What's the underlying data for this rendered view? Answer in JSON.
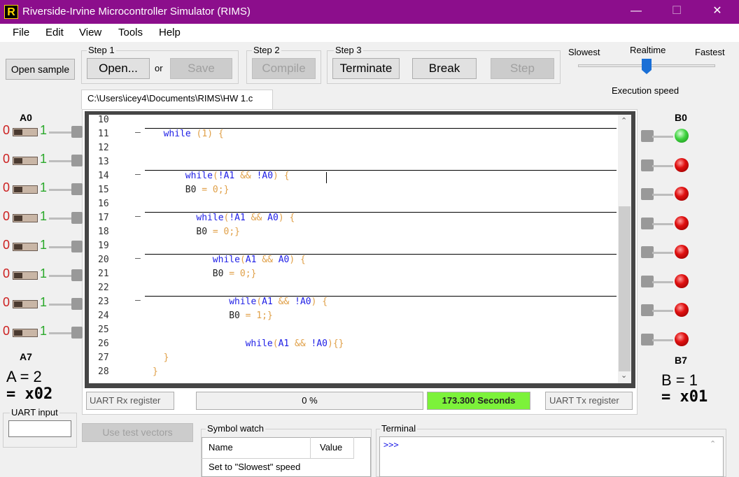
{
  "window": {
    "icon_letter": "R",
    "title": "Riverside-Irvine Microcontroller Simulator (RIMS)",
    "minimize": "—",
    "maximize": "☐",
    "close": "✕"
  },
  "menu": [
    "File",
    "Edit",
    "View",
    "Tools",
    "Help"
  ],
  "toolbar": {
    "open_sample": "Open sample",
    "step1": "Step 1",
    "open": "Open...",
    "or": "or",
    "save": "Save",
    "step2": "Step 2",
    "compile": "Compile",
    "step3": "Step 3",
    "terminate": "Terminate",
    "break": "Break",
    "step": "Step"
  },
  "speed": {
    "slowest": "Slowest",
    "realtime": "Realtime",
    "fastest": "Fastest",
    "label": "Execution speed",
    "level": 0.45
  },
  "file_tab": "C:\\Users\\icey4\\Documents\\RIMS\\HW 1.c",
  "inputs": {
    "top_label": "A0",
    "bottom_label": "A7",
    "off": "0",
    "on": "1",
    "value_line1": "A = 2",
    "value_line2": "= x02"
  },
  "outputs": {
    "top_label": "B0",
    "bottom_label": "B7",
    "value_line1": "B = 1",
    "value_line2": "= x01",
    "leds": [
      "on",
      "off",
      "off",
      "off",
      "off",
      "off",
      "off",
      "off"
    ]
  },
  "code": {
    "line_numbers": [
      "10",
      "11",
      "12",
      "13",
      "14",
      "15",
      "16",
      "17",
      "18",
      "19",
      "20",
      "21",
      "22",
      "23",
      "24",
      "25",
      "26",
      "27",
      "28"
    ],
    "lines": [
      {
        "indent": "",
        "tokens": []
      },
      {
        "indent": "  ",
        "tokens": [
          [
            "kw",
            "while"
          ],
          [
            "op",
            " (1) {"
          ]
        ]
      },
      {
        "indent": "",
        "tokens": []
      },
      {
        "indent": "",
        "tokens": []
      },
      {
        "indent": "      ",
        "tokens": [
          [
            "kw",
            "while"
          ],
          [
            "op",
            "("
          ],
          [
            "kw",
            "!A1"
          ],
          [
            "op",
            " && "
          ],
          [
            "kw",
            "!A0"
          ],
          [
            "op",
            ") {"
          ]
        ]
      },
      {
        "indent": "      ",
        "tokens": [
          [
            "id",
            "B0 "
          ],
          [
            "op",
            "= 0;}"
          ]
        ]
      },
      {
        "indent": "",
        "tokens": []
      },
      {
        "indent": "        ",
        "tokens": [
          [
            "kw",
            "while"
          ],
          [
            "op",
            "("
          ],
          [
            "kw",
            "!A1"
          ],
          [
            "op",
            " && "
          ],
          [
            "kw",
            "A0"
          ],
          [
            "op",
            ") {"
          ]
        ]
      },
      {
        "indent": "        ",
        "tokens": [
          [
            "id",
            "B0 "
          ],
          [
            "op",
            "= 0;}"
          ]
        ]
      },
      {
        "indent": "",
        "tokens": []
      },
      {
        "indent": "           ",
        "tokens": [
          [
            "kw",
            "while"
          ],
          [
            "op",
            "("
          ],
          [
            "kw",
            "A1"
          ],
          [
            "op",
            " && "
          ],
          [
            "kw",
            "A0"
          ],
          [
            "op",
            ") {"
          ]
        ]
      },
      {
        "indent": "           ",
        "tokens": [
          [
            "id",
            "B0 "
          ],
          [
            "op",
            "= 0;}"
          ]
        ]
      },
      {
        "indent": "",
        "tokens": []
      },
      {
        "indent": "              ",
        "tokens": [
          [
            "kw",
            "while"
          ],
          [
            "op",
            "("
          ],
          [
            "kw",
            "A1"
          ],
          [
            "op",
            " && "
          ],
          [
            "kw",
            "!A0"
          ],
          [
            "op",
            ") {"
          ]
        ]
      },
      {
        "indent": "              ",
        "tokens": [
          [
            "id",
            "B0 "
          ],
          [
            "op",
            "= 1;}"
          ]
        ]
      },
      {
        "indent": "",
        "tokens": []
      },
      {
        "indent": "                 ",
        "tokens": [
          [
            "kw",
            "while"
          ],
          [
            "op",
            "("
          ],
          [
            "kw",
            "A1"
          ],
          [
            "op",
            " && "
          ],
          [
            "kw",
            "!A0"
          ],
          [
            "op",
            "){}"
          ]
        ]
      },
      {
        "indent": "  ",
        "tokens": [
          [
            "op",
            "}"
          ]
        ]
      },
      {
        "indent": "",
        "tokens": [
          [
            "op",
            "}"
          ]
        ]
      }
    ]
  },
  "status": {
    "uart_rx": "UART Rx register",
    "progress": "0 %",
    "time": "173.300 Seconds",
    "uart_tx": "UART Tx register"
  },
  "uart_input": {
    "label": "UART input",
    "value": ""
  },
  "test_vectors": "Use test vectors",
  "symbol_watch": {
    "label": "Symbol watch",
    "col_name": "Name",
    "col_value": "Value",
    "row1": "Set to \"Slowest\" speed"
  },
  "terminal": {
    "label": "Terminal",
    "prompt": ">>>"
  }
}
